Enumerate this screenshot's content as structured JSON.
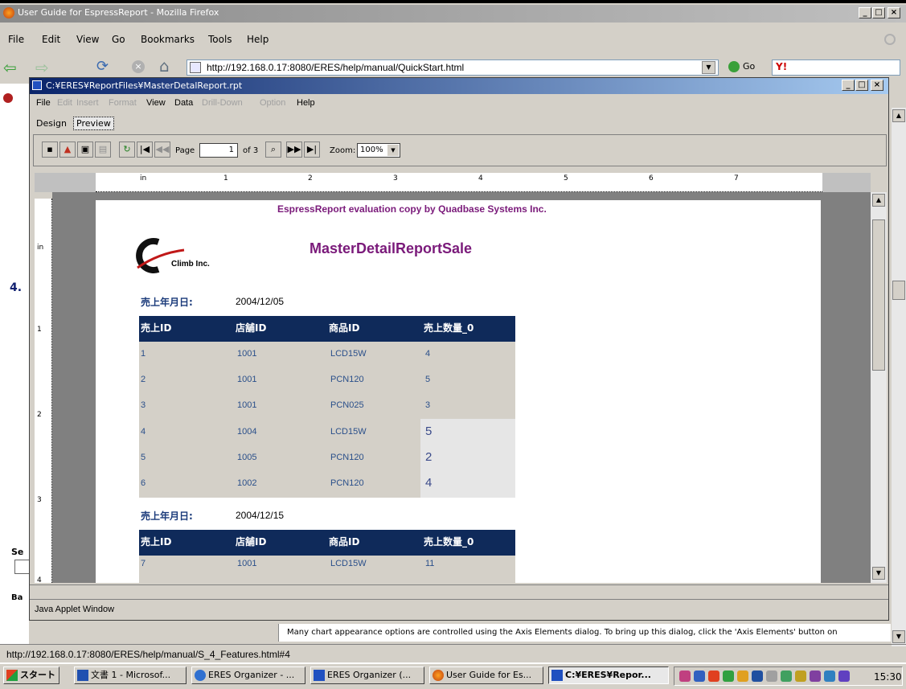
{
  "browser": {
    "title": "User Guide for EspressReport - Mozilla Firefox",
    "menu": [
      "File",
      "Edit",
      "View",
      "Go",
      "Bookmarks",
      "Tools",
      "Help"
    ],
    "url": "http://192.168.0.17:8080/ERES/help/manual/QuickStart.html",
    "go_label": "Go",
    "status_url": "http://192.168.0.17:8080/ERES/help/manual/S_4_Features.html#4",
    "bottom_text": "Many chart appearance options are controlled using the Axis Elements dialog.  To bring up this dialog, click the 'Axis Elements' button on",
    "left_heading": "4.",
    "left_frag_se": "Se",
    "left_frag_ba": "Ba"
  },
  "applet": {
    "title": "C:¥ERES¥ReportFiles¥MasterDetalReport.rpt",
    "menu": [
      "File",
      "Edit",
      "Insert",
      "Format",
      "View",
      "Data",
      "Drill-Down",
      "Option",
      "Help"
    ],
    "tabs": [
      "Design",
      "Preview"
    ],
    "page_label": "Page",
    "page_value": "1",
    "of_label": "of 3",
    "zoom_label": "Zoom:",
    "zoom_value": "100%",
    "status": "Java Applet Window",
    "ruler_unit": "in",
    "ruler_numbers": [
      "1",
      "2",
      "3",
      "4",
      "5",
      "6",
      "7"
    ],
    "vruler_numbers": [
      "in",
      "1",
      "2",
      "3",
      "4"
    ]
  },
  "report": {
    "watermark": "EspressReport evaluation copy by Quadbase Systems Inc.",
    "logo_text": "Climb Inc.",
    "title": "MasterDetailReportSale",
    "groups": [
      {
        "date_label": "売上年月日:",
        "date_value": "2004/12/05",
        "headers": [
          "売上ID",
          "店舗ID",
          "商品ID",
          "売上数量_0"
        ],
        "rows": [
          [
            "1",
            "1001",
            "LCD15W",
            "4"
          ],
          [
            "2",
            "1001",
            "PCN120",
            "5"
          ],
          [
            "3",
            "1001",
            "PCN025",
            "3"
          ],
          [
            "4",
            "1004",
            "LCD15W",
            "5"
          ],
          [
            "5",
            "1005",
            "PCN120",
            "2"
          ],
          [
            "6",
            "1002",
            "PCN120",
            "4"
          ]
        ]
      },
      {
        "date_label": "売上年月日:",
        "date_value": "2004/12/15",
        "headers": [
          "売上ID",
          "店舗ID",
          "商品ID",
          "売上数量_0"
        ],
        "rows": [
          [
            "7",
            "1001",
            "LCD15W",
            "11"
          ]
        ]
      }
    ]
  },
  "taskbar": {
    "start": "スタート",
    "buttons": [
      "文書 1 - Microsof...",
      "ERES Organizer - ...",
      "ERES Organizer (...",
      "User Guide for Es...",
      "C:¥ERES¥Repor..."
    ],
    "clock": "15:30"
  },
  "colors": {
    "header_bg": "#0f2a5a",
    "row_bg": "#d4d0c8",
    "title_color": "#7a1a7a",
    "titlebar_active": "#0a246a"
  }
}
